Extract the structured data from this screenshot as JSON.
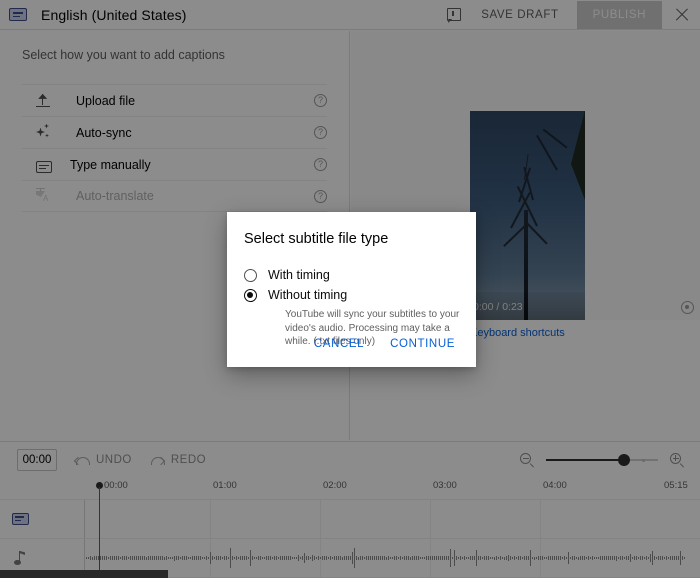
{
  "header": {
    "cc_icon": "closed-caption-icon",
    "title": "English (United States)",
    "feedback_icon": "feedback-icon",
    "save_draft_label": "SAVE DRAFT",
    "publish_label": "PUBLISH",
    "publish_disabled": true,
    "close_icon": "close-icon"
  },
  "left_panel": {
    "subtitle": "Select how you want to add captions",
    "help_glyph": "?",
    "methods": [
      {
        "label": "Upload file",
        "icon": "upload-icon",
        "disabled": false
      },
      {
        "label": "Auto-sync",
        "icon": "sparkle-icon",
        "disabled": false
      },
      {
        "label": "Type manually",
        "icon": "caption-icon",
        "disabled": false
      },
      {
        "label": "Auto-translate",
        "icon": "translate-icon",
        "disabled": true
      }
    ]
  },
  "video": {
    "time_display": "0:00 / 0:23",
    "duration": "0:23",
    "settings_icon": "gear-icon",
    "keyboard_shortcuts_label": "Keyboard shortcuts"
  },
  "timeline_toolbar": {
    "current_time": "00:00",
    "undo_label": "UNDO",
    "redo_label": "REDO",
    "zoom_out_icon": "zoom-out-icon",
    "zoom_in_icon": "zoom-in-icon",
    "zoom_value": 78
  },
  "timeline": {
    "ruler_labels": [
      "00:00",
      "01:00",
      "02:00",
      "03:00",
      "04:00",
      "05:15"
    ],
    "playhead_time": "00:00",
    "tracks": [
      {
        "name": "captions-track",
        "icon": "closed-caption-icon"
      },
      {
        "name": "audio-track",
        "icon": "music-note-icon"
      }
    ]
  },
  "dialog": {
    "title": "Select subtitle file type",
    "options": [
      {
        "label": "With timing",
        "selected": false
      },
      {
        "label": "Without timing",
        "selected": true
      }
    ],
    "help_text": "YouTube will sync your subtitles to your video's audio. Processing may take a while. (.txt files only)",
    "cancel_label": "CANCEL",
    "continue_label": "CONTINUE"
  },
  "colors": {
    "accent_blue": "#065fd4",
    "cc_blue": "#3c4b8a",
    "disabled_grey": "#cccccc",
    "text_primary": "#030303",
    "text_secondary": "#606060"
  }
}
